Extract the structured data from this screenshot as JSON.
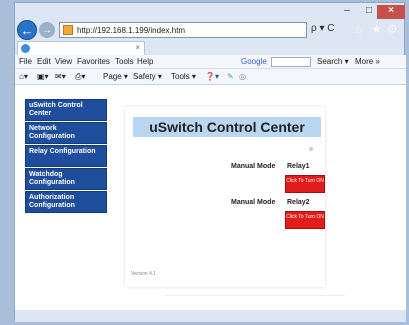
{
  "browser": {
    "address": "http://192.168.1.199/index.htm",
    "tab_close": "×",
    "address_tools": "ρ ▾ C",
    "search_provider": "Google",
    "search_label": "Search ▾",
    "more_label": "More »"
  },
  "menubar": {
    "items": [
      "File",
      "Edit",
      "View",
      "Favorites",
      "Tools",
      "Help"
    ]
  },
  "cmdbar": {
    "items": [
      "Page ▾",
      "Safety ▾",
      "Tools ▾"
    ]
  },
  "sidenav": {
    "items": [
      "uSwitch Control Center",
      "Network Configuration",
      "Relay Configuration",
      "Watchdog Configuration",
      "Authorization Configuration"
    ]
  },
  "panel": {
    "title": "uSwitch Control Center",
    "relays": [
      {
        "mode": "Manual Mode",
        "name": "Relay1",
        "button": "Click To Turn ON"
      },
      {
        "mode": "Manual Mode",
        "name": "Relay2",
        "button": "Click To Turn ON"
      }
    ],
    "version": "Version 4.1"
  },
  "colors": {
    "nav_bg": "#1e4d9b",
    "title_bg": "#b9d7f1",
    "button_red": "#e21b1b"
  }
}
